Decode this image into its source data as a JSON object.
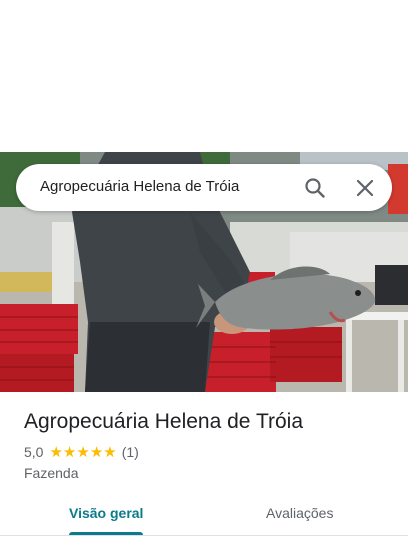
{
  "search": {
    "query": "Agropecuária Helena de Tróia"
  },
  "place": {
    "title": "Agropecuária Helena de Tróia",
    "rating": "5,0",
    "stars_count": 5,
    "review_count": "(1)",
    "category": "Fazenda"
  },
  "tabs": [
    {
      "label": "Visão geral",
      "active": true
    },
    {
      "label": "Avaliações",
      "active": false
    }
  ],
  "icons": {
    "search": "search-icon",
    "close": "close-icon",
    "star": "star-icon"
  },
  "colors": {
    "accent": "#0b7a8a",
    "star": "#fbbc04",
    "text": "#202124",
    "muted": "#5f6368"
  }
}
